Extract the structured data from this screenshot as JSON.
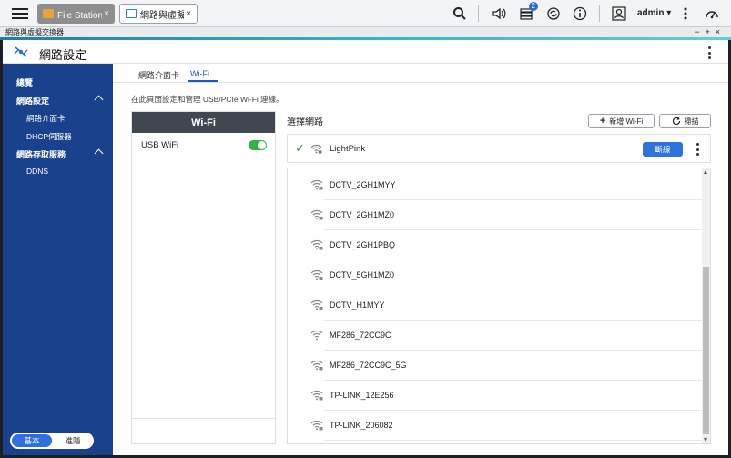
{
  "taskbar": {
    "tabs": [
      {
        "label": "File Station 檔...",
        "close": "×"
      },
      {
        "label": "網路與虛擬交換...",
        "close": "×"
      }
    ],
    "notification_count": "2",
    "user": "admin ▾"
  },
  "window": {
    "title": "網路與虛擬交換器",
    "controls": "−+×"
  },
  "app": {
    "title": "網路設定"
  },
  "sidebar": {
    "items": [
      {
        "label": "總覽"
      },
      {
        "label": "網路設定"
      },
      {
        "label": "網路介面卡"
      },
      {
        "label": "DHCP伺服器"
      },
      {
        "label": "網路存取服務"
      },
      {
        "label": "DDNS"
      }
    ],
    "mode": {
      "basic": "基本",
      "advanced": "進階"
    }
  },
  "main": {
    "tabs": [
      {
        "label": "網路介面卡"
      },
      {
        "label": "Wi-Fi"
      }
    ],
    "description": "在此頁面設定和管理 USB/PCIe Wi-Fi 連線。",
    "wifi_panel": {
      "header": "Wi-Fi",
      "usb_label": "USB WiFi",
      "usb_enabled": true
    },
    "select_title": "選擇網路",
    "add_wifi": "新增 Wi-Fi",
    "scan": "掃描",
    "connected": {
      "name": "LightPink",
      "disconnect": "斷線"
    },
    "networks": [
      {
        "name": "DCTV_2GH1MYY",
        "locked": true
      },
      {
        "name": "DCTV_2GH1MZ0",
        "locked": true
      },
      {
        "name": "DCTV_2GH1PBQ",
        "locked": true
      },
      {
        "name": "DCTV_5GH1MZ0",
        "locked": true
      },
      {
        "name": "DCTV_H1MYY",
        "locked": true
      },
      {
        "name": "MF286_72CC9C",
        "locked": false
      },
      {
        "name": "MF286_72CC9C_5G",
        "locked": true
      },
      {
        "name": "TP-LINK_12E256",
        "locked": true
      },
      {
        "name": "TP-LINK_206082",
        "locked": true
      }
    ]
  },
  "colors": {
    "sidebar": "#19418c",
    "accent_blue": "#2e72dd",
    "switch_on": "#34b24a",
    "panel_header": "#404750"
  }
}
